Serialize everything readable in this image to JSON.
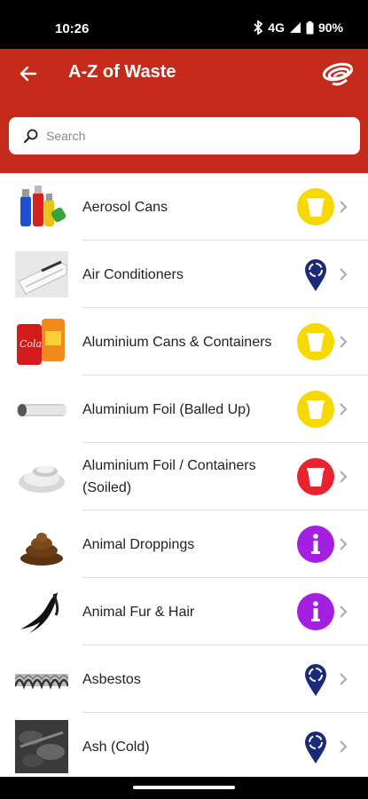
{
  "status_bar": {
    "time": "10:26",
    "network": "4G",
    "battery": "90%"
  },
  "header": {
    "title": "A-Z of Waste",
    "back_icon": "arrow-left-icon",
    "logo": "swirl-logo"
  },
  "search": {
    "placeholder": "Search",
    "value": ""
  },
  "colors": {
    "brand_red": "#c62a1a",
    "bin_yellow": "#f7d800",
    "bin_red": "#e8232d",
    "info_purple": "#a51fe0",
    "location_navy": "#1a2a78"
  },
  "items": [
    {
      "label": "Aerosol Cans",
      "thumb": "aerosol-cans-image",
      "status": "yellow-bin"
    },
    {
      "label": "Air Conditioners",
      "thumb": "air-conditioner-image",
      "status": "recycle-location"
    },
    {
      "label": "Aluminium Cans & Containers",
      "thumb": "aluminium-cans-image",
      "status": "yellow-bin"
    },
    {
      "label": "Aluminium Foil (Balled Up)",
      "thumb": "aluminium-foil-image",
      "status": "yellow-bin"
    },
    {
      "label": "Aluminium Foil / Containers (Soiled)",
      "thumb": "foil-containers-image",
      "status": "red-bin"
    },
    {
      "label": "Animal Droppings",
      "thumb": "animal-droppings-image",
      "status": "info"
    },
    {
      "label": "Animal Fur & Hair",
      "thumb": "animal-fur-image",
      "status": "info"
    },
    {
      "label": "Asbestos",
      "thumb": "asbestos-image",
      "status": "recycle-location"
    },
    {
      "label": "Ash (Cold)",
      "thumb": "ash-image",
      "status": "recycle-location"
    }
  ]
}
